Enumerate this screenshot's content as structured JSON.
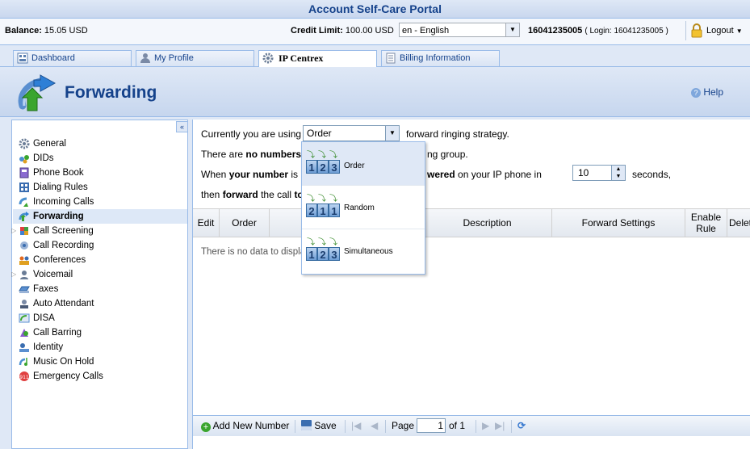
{
  "app": {
    "title": "Account Self-Care Portal"
  },
  "status": {
    "balance_label": "Balance:",
    "balance_value": "15.05 USD",
    "credit_label": "Credit Limit:",
    "credit_value": "100.00 USD",
    "language": "en - English",
    "account_number": "16041235005",
    "login_text": "( Login: 16041235005 )",
    "logout": "Logout"
  },
  "tabs": [
    {
      "label": "Dashboard"
    },
    {
      "label": "My Profile"
    },
    {
      "label": "IP Centrex"
    },
    {
      "label": "Billing Information"
    }
  ],
  "page": {
    "title": "Forwarding",
    "help": "Help"
  },
  "sidebar": {
    "collapse": "«",
    "items": [
      {
        "label": "General"
      },
      {
        "label": "DIDs"
      },
      {
        "label": "Phone Book"
      },
      {
        "label": "Dialing Rules"
      },
      {
        "label": "Incoming Calls"
      },
      {
        "label": "Forwarding"
      },
      {
        "label": "Call Screening"
      },
      {
        "label": "Call Recording"
      },
      {
        "label": "Conferences"
      },
      {
        "label": "Voicemail"
      },
      {
        "label": "Faxes"
      },
      {
        "label": "Auto Attendant"
      },
      {
        "label": "DISA"
      },
      {
        "label": "Call Barring"
      },
      {
        "label": "Identity"
      },
      {
        "label": "Music On Hold"
      },
      {
        "label": "Emergency Calls"
      }
    ]
  },
  "main": {
    "line1_pre": "Currently you are using",
    "strategy_value": "Order",
    "line1_post": "forward ringing strategy.",
    "line2_pre": "There are",
    "line2_bold": "no numbers",
    "line2_tail": "ng group.",
    "line3_pre": "When",
    "line3_bold": "your number",
    "line3_mid": "is",
    "line3_bold2": "wered",
    "line3_post": "on your IP phone in",
    "seconds_value": "10",
    "seconds_label": "seconds,",
    "line4_pre": "then",
    "line4_bold": "forward",
    "line4_mid": "the call",
    "line4_bold2": "to"
  },
  "grid": {
    "columns": [
      "Edit",
      "Order",
      "Description",
      "Forward Settings",
      "Enable Rule",
      "Delete"
    ],
    "empty_text": "There is no data to display"
  },
  "strategy_options": [
    {
      "label": "Order",
      "digits": [
        "1",
        "2",
        "3"
      ]
    },
    {
      "label": "Random",
      "digits": [
        "2",
        "1",
        "1"
      ]
    },
    {
      "label": "Simultaneous",
      "digits": [
        "1",
        "2",
        "3"
      ]
    }
  ],
  "toolbar": {
    "add_new": "Add New Number",
    "save": "Save",
    "page_label": "Page",
    "page_value": "1",
    "of_text": "of 1"
  }
}
